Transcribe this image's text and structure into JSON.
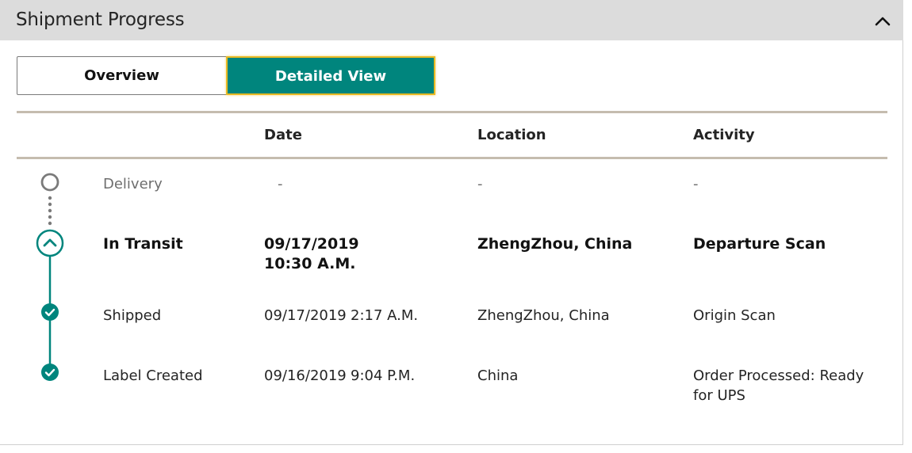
{
  "header": {
    "title": "Shipment Progress",
    "collapse_icon": "chevron-up-icon"
  },
  "view_toggle": {
    "overview_label": "Overview",
    "detailed_label": "Detailed View",
    "selected": "Detailed View"
  },
  "table": {
    "columns": [
      "",
      "Date",
      "Location",
      "Activity"
    ],
    "rows": [
      {
        "status": "Delivery",
        "date": "-",
        "time": "",
        "location": "-",
        "activity": "-",
        "state": "pending",
        "icon": "empty-circle-icon"
      },
      {
        "status": "In Transit",
        "date": "09/17/2019",
        "time": "10:30 A.M.",
        "location": "ZhengZhou, China",
        "activity": "Departure Scan",
        "state": "current",
        "icon": "chevron-up-circle-icon"
      },
      {
        "status": "Shipped",
        "date": "09/17/2019",
        "time": "2:17 A.M.",
        "location": "ZhengZhou, China",
        "activity": "Origin Scan",
        "state": "done",
        "icon": "checkmark-circle-icon"
      },
      {
        "status": "Label Created",
        "date": "09/16/2019",
        "time": "9:04 P.M.",
        "location": "China",
        "activity": "Order Processed: Ready for UPS",
        "state": "done",
        "icon": "checkmark-circle-icon"
      }
    ]
  },
  "colors": {
    "accent": "#00857d",
    "focus_ring": "#e8b923",
    "header_bg": "#dcdcdc",
    "rule": "#c5bcaf",
    "pending_node": "#7a7a7a"
  }
}
